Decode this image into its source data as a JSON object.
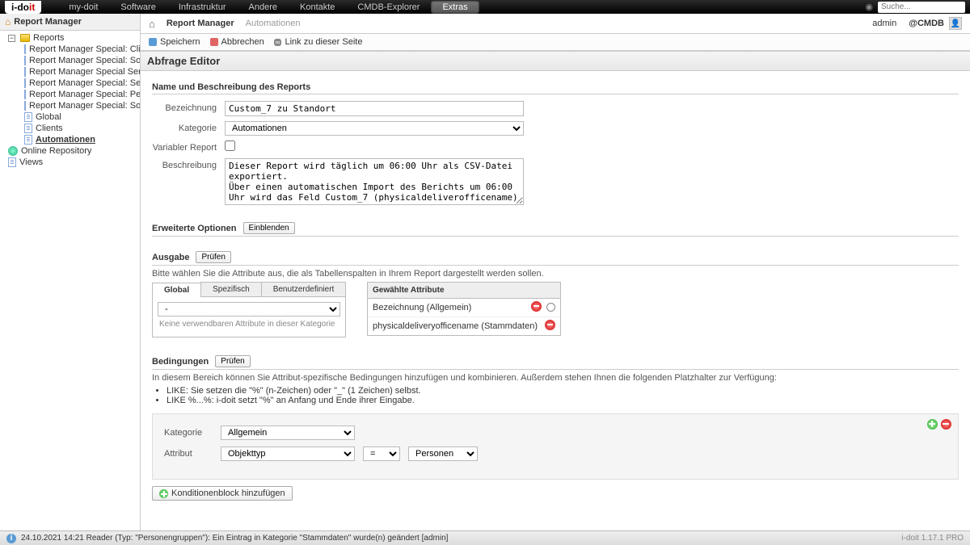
{
  "brand": {
    "name": "i-do",
    "accent": "it"
  },
  "topnav": [
    "my-doit",
    "Software",
    "Infrastruktur",
    "Andere",
    "Kontakte",
    "CMDB-Explorer",
    "Extras"
  ],
  "topnav_active": "Extras",
  "search": {
    "placeholder": "Suche..."
  },
  "sidebar": {
    "header": "Report Manager",
    "root": "Reports",
    "items": [
      "Report Manager Special: Clients",
      "Report Manager Special: Sonstiges",
      "Report Manager Special Server",
      "Report Manager Special: Services",
      "Report Manager Special: Peripherie",
      "Report Manager Special: Software",
      "Global",
      "Clients",
      "Automationen"
    ],
    "extra": [
      "Online Repository",
      "Views"
    ]
  },
  "breadcrumb": {
    "a": "Report Manager",
    "b": "Automationen"
  },
  "user": {
    "name": "admin",
    "tenant": "@CMDB"
  },
  "toolbar": {
    "save": "Speichern",
    "cancel": "Abbrechen",
    "link": "Link zu dieser Seite"
  },
  "editor_title": "Abfrage Editor",
  "sec_desc": {
    "title": "Name und Beschreibung des Reports",
    "l_bez": "Bezeichnung",
    "v_bez": "Custom_7 zu Standort",
    "l_kat": "Kategorie",
    "v_kat": "Automationen",
    "l_var": "Variabler Report",
    "l_besch": "Beschreibung",
    "v_besch": "Dieser Report wird täglich um 06:00 Uhr als CSV-Datei exportiert.\nÜber einen automatischen Import des Berichts um 06:00 Uhr wird das Feld Custom_7 (physicaldeliverofficename) für die Angabe des Standortes verwendet."
  },
  "sec_opt": {
    "title": "Erweiterte Optionen",
    "btn": "Einblenden"
  },
  "sec_out": {
    "title": "Ausgabe",
    "btn": "Prüfen",
    "hint": "Bitte wählen Sie die Attribute aus, die als Tabellenspalten in Ihrem Report dargestellt werden sollen.",
    "tabs": [
      "Global",
      "Spezifisch",
      "Benutzerdefiniert"
    ],
    "empty": "Keine verwendbaren Attribute in dieser Kategorie",
    "dash": "-",
    "chosen_title": "Gewählte Attribute",
    "chosen": [
      "Bezeichnung (Allgemein)",
      "physicaldeliveryofficename (Stammdaten)"
    ]
  },
  "sec_cond": {
    "title": "Bedingungen",
    "btn": "Prüfen",
    "hint": "In diesem Bereich können Sie Attribut-spezifische Bedingungen hinzufügen und kombinieren. Außerdem stehen Ihnen die folgenden Platzhalter zur Verfügung:",
    "bullets": [
      "LIKE: Sie setzen die \"%\" (n-Zeichen) oder \"_\" (1 Zeichen) selbst.",
      "LIKE %...%: i-doit setzt \"%\" an Anfang und Ende ihrer Eingabe."
    ],
    "l_kat": "Kategorie",
    "v_kat": "Allgemein",
    "l_attr": "Attribut",
    "v_attr": "Objekttyp",
    "op": "=",
    "val": "Personen",
    "add": "Konditionenblock hinzufügen"
  },
  "footer": {
    "msg": "24.10.2021 14:21 Reader (Typ: \"Personengruppen\"): Ein Eintrag in Kategorie \"Stammdaten\" wurde(n) geändert [admin]",
    "ver": "i-doit 1.17.1 PRO"
  }
}
